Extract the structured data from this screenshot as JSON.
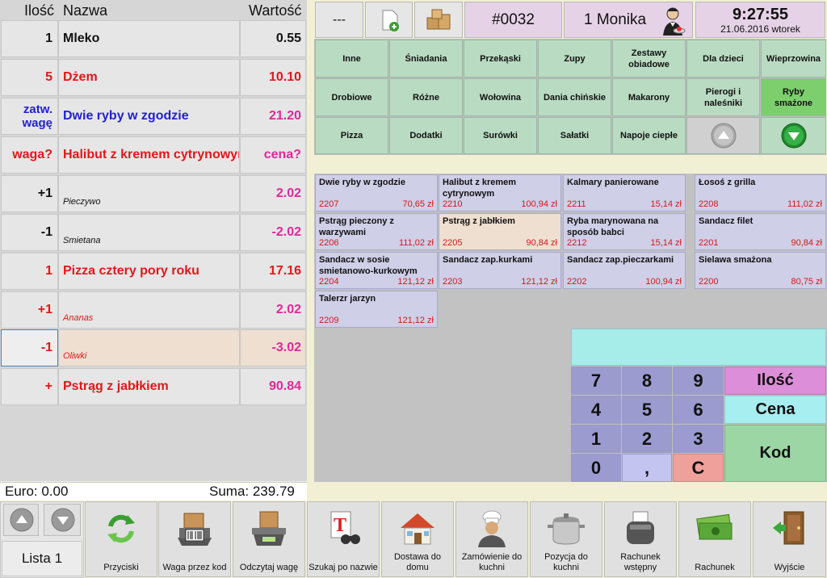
{
  "headers": {
    "qty": "Ilość",
    "name": "Nazwa",
    "value": "Wartość"
  },
  "rows": [
    {
      "qty": "1",
      "name": "Mleko",
      "value": "0.55"
    },
    {
      "qty": "5",
      "name": "Dżem",
      "value": "10.10"
    },
    {
      "qty": "zatw. wagę",
      "name": "Dwie ryby w zgodzie",
      "value": "21.20"
    },
    {
      "qty": "waga?",
      "name": "Halibut z kremem cytrynowym",
      "value": "cena?"
    },
    {
      "qty": "+1",
      "name": "Pieczywo",
      "value": "2.02"
    },
    {
      "qty": "-1",
      "name": "Smietana",
      "value": "-2.02"
    },
    {
      "qty": "1",
      "name": "Pizza cztery pory roku",
      "value": "17.16"
    },
    {
      "qty": "+1",
      "name": "Ananas",
      "value": "2.02"
    },
    {
      "qty": "-1",
      "name": "Oliwki",
      "value": "-3.02"
    },
    {
      "qty": "+",
      "name": "Pstrąg z jabłkiem",
      "value": "90.84"
    }
  ],
  "summary": {
    "euro": "Euro: 0.00",
    "suma": "Suma: 239.79"
  },
  "list_label": "Lista 1",
  "topbar": {
    "dash": "---",
    "order_no": "#0032",
    "waiter": "1 Monika",
    "time": "9:27:55",
    "date": "21.06.2016 wtorek"
  },
  "categories": [
    "Inne",
    "Śniadania",
    "Przekąski",
    "Zupy",
    "Zestawy obiadowe",
    "Dla dzieci",
    "Wieprzowina",
    "Drobiowe",
    "Różne",
    "Wołowina",
    "Dania chińskie",
    "Makarony",
    "Pierogi i naleśniki",
    "Ryby smażone",
    "Pizza",
    "Dodatki",
    "Surówki",
    "Sałatki",
    "Napoje ciepłe"
  ],
  "products": [
    {
      "name": "Dwie ryby w zgodzie",
      "code": "2207",
      "price": "70,65 zł"
    },
    {
      "name": "Halibut z kremem cytrynowym",
      "code": "2210",
      "price": "100,94 zł"
    },
    {
      "name": "Kalmary panierowane",
      "code": "2211",
      "price": "15,14 zł"
    },
    {
      "name": "Łosoś z grilla",
      "code": "2208",
      "price": "111,02 zł"
    },
    {
      "name": "Pstrąg pieczony z warzywami",
      "code": "2206",
      "price": "111,02 zł"
    },
    {
      "name": "Pstrąg z jabłkiem",
      "code": "2205",
      "price": "90,84 zł"
    },
    {
      "name": "Ryba marynowana na sposób babci",
      "code": "2212",
      "price": "15,14 zł"
    },
    {
      "name": "Sandacz filet",
      "code": "2201",
      "price": "90,84 zł"
    },
    {
      "name": "Sandacz w sosie smietanowo-kurkowym",
      "code": "2204",
      "price": "121,12 zł"
    },
    {
      "name": "Sandacz zap.kurkami",
      "code": "2203",
      "price": "121,12 zł"
    },
    {
      "name": "Sandacz zap.pieczarkami",
      "code": "2202",
      "price": "100,94 zł"
    },
    {
      "name": "Sielawa smażona",
      "code": "2200",
      "price": "80,75 zł"
    },
    {
      "name": "Talerzr jarzyn",
      "code": "2209",
      "price": "121,12 zł"
    }
  ],
  "keypad": {
    "k7": "7",
    "k8": "8",
    "k9": "9",
    "k4": "4",
    "k5": "5",
    "k6": "6",
    "k1": "1",
    "k2": "2",
    "k3": "3",
    "k0": "0",
    "comma": ",",
    "clear": "C",
    "qty": "Ilość",
    "price": "Cena",
    "code": "Kod"
  },
  "bottom": [
    "Przyciski",
    "Waga przez kod",
    "Odczytaj wagę",
    "Szukaj po nazwie",
    "Dostawa do domu",
    "Zamówienie do kuchni",
    "Pozycja do kuchni",
    "Rachunek wstępny",
    "Rachunek",
    "Wyjście"
  ],
  "colors": {
    "category_bg": "#b9dbc2",
    "product_bg": "#cfcfe8",
    "keypad_bg": "#9b9bd0",
    "order_bg": "#e6e6e6",
    "qty_key": "#dc8ed8",
    "price_key": "#a6eef0",
    "code_key": "#9bd6a4",
    "clear_key": "#f0a09a",
    "display": "#a6ece8"
  }
}
